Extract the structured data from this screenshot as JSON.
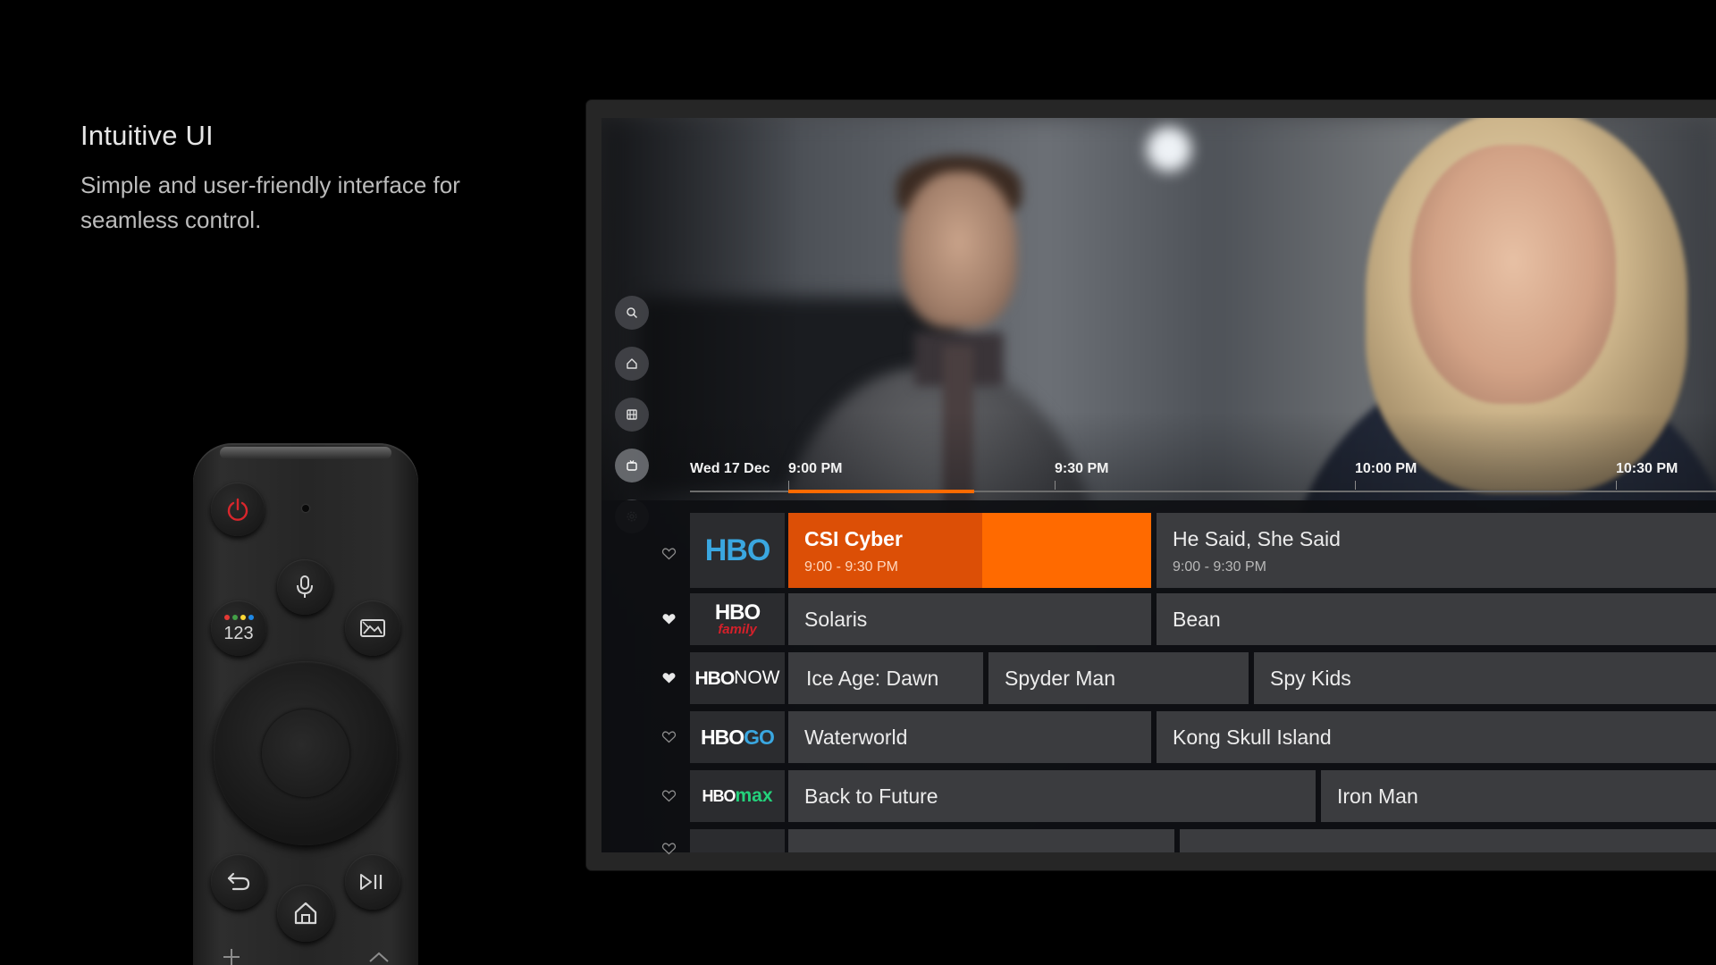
{
  "headline": {
    "title": "Intuitive UI",
    "description": "Simple and user-friendly interface for seamless control."
  },
  "remote": {
    "number_button_label": "123",
    "buttons": [
      "power-icon",
      "mic-icon",
      "number-button",
      "ambient-icon",
      "back-icon",
      "home-icon",
      "play-pause-icon",
      "plus-icon",
      "chevron-up-icon"
    ],
    "number_dot_colors": [
      "#e53935",
      "#43a047",
      "#fdd835",
      "#1e88e5"
    ]
  },
  "colors": {
    "accent": "#ff6a00",
    "accent_elapsed": "#dc4f06",
    "power_red": "#d9262c",
    "hbo_blue": "#3aa7e0",
    "hbo_family_red": "#d5202a",
    "hbo_go_blue": "#3aa7e0",
    "hbo_max_green": "#24d17b"
  },
  "tv": {
    "side_nav": [
      "search-icon",
      "home-icon",
      "movies-icon",
      "live-tv-icon",
      "settings-icon"
    ],
    "timeline": {
      "date": "Wed 17 Dec",
      "times": [
        "9:00 PM",
        "9:30 PM",
        "10:00 PM",
        "10:30 PM"
      ],
      "progress": 0.46
    },
    "channels": [
      {
        "logo": "HBO",
        "favorite": false,
        "programs": [
          {
            "title": "CSI Cyber",
            "time": "9:00 - 9:30 PM",
            "active": true
          },
          {
            "title": "He Said, She Said",
            "time": "9:00 - 9:30 PM"
          }
        ]
      },
      {
        "logo": "HBO family",
        "logo_sub": "family",
        "favorite": true,
        "programs": [
          {
            "title": "Solaris"
          },
          {
            "title": "Bean"
          }
        ]
      },
      {
        "logo": "HBONOW",
        "logo_sub": "NOW",
        "favorite": true,
        "programs": [
          {
            "title": "Ice Age: Dawn"
          },
          {
            "title": "Spyder Man"
          },
          {
            "title": "Spy Kids"
          }
        ]
      },
      {
        "logo": "HBOGO",
        "logo_sub": "GO",
        "favorite": false,
        "programs": [
          {
            "title": "Waterworld"
          },
          {
            "title": "Kong Skull Island"
          }
        ]
      },
      {
        "logo": "HBOmax",
        "logo_sub": "max",
        "favorite": false,
        "programs": [
          {
            "title": "Back to Future"
          },
          {
            "title": "Iron Man"
          }
        ]
      }
    ]
  }
}
